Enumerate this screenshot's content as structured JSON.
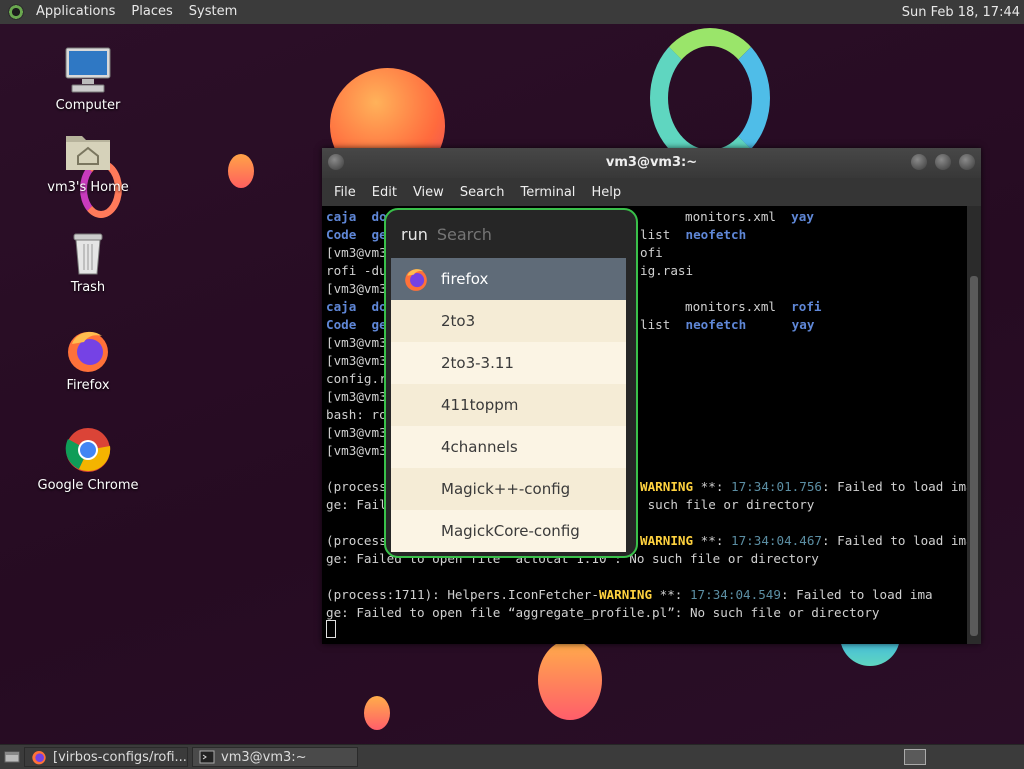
{
  "top_panel": {
    "menus": [
      "Applications",
      "Places",
      "System"
    ],
    "clock": "Sun Feb 18, 17:44"
  },
  "desktop_icons": [
    {
      "label": "Computer",
      "icon": "computer-icon"
    },
    {
      "label": "vm3's Home",
      "icon": "home-folder-icon"
    },
    {
      "label": "Trash",
      "icon": "trash-icon"
    },
    {
      "label": "Firefox",
      "icon": "firefox-icon"
    },
    {
      "label": "Google Chrome",
      "icon": "chrome-icon"
    }
  ],
  "terminal": {
    "title": "vm3@vm3:~",
    "menus": [
      "File",
      "Edit",
      "View",
      "Search",
      "Terminal",
      "Help"
    ],
    "lines": {
      "l1a": "caja  do",
      "l1b": "monitors.xml  ",
      "l1c": "yay",
      "l2a": "Code  ge",
      "l2b": "list  ",
      "l2c": "neofetch",
      "l3a": "[vm3@vm3",
      "l3b": "ofi",
      "l4a": "rofi -du",
      "l4b": "ig.rasi",
      "l5a": "[vm3@vm3",
      "l6a": "caja  do",
      "l6b": "monitors.xml  ",
      "l6c": "rofi",
      "l7a": "Code  ge",
      "l7b": "list  ",
      "l7c": "neofetch      ",
      "l7d": "yay",
      "l8a": "[vm3@vm3",
      "l9a": "[vm3@vm3",
      "l10a": "config.r",
      "l11a": "[vm3@vm3",
      "l12a": "bash: ro",
      "l13a": "[vm3@vm3",
      "l14a": "[vm3@vm3",
      "w1a": "(process",
      "w1b": "WARNING",
      "w1c": " **: ",
      "w1d": "17:34:01.756",
      "w1e": ": Failed to load ima",
      "w1f": "ge: Fail",
      "w1g": " such file or directory",
      "w2a": "(process",
      "w2b": "WARNING",
      "w2c": " **: ",
      "w2d": "17:34:04.467",
      "w2e": ": Failed to load ima",
      "w2f": "ge: Failed to open file “actocat 1.10”: No such file or directory",
      "w3a": "(process:1711): Helpers.IconFetcher-",
      "w3b": "WARNING",
      "w3c": " **: ",
      "w3d": "17:34:04.549",
      "w3e": ": Failed to load ima",
      "w3f": "ge: Failed to open file “aggregate_profile.pl”: No such file or directory"
    }
  },
  "rofi": {
    "prompt": "run",
    "placeholder": "Search",
    "items": [
      "firefox",
      "2to3",
      "2to3-3.11",
      "411toppm",
      "4channels",
      "Magick++-config",
      "MagickCore-config"
    ]
  },
  "taskbar": {
    "tasks": [
      {
        "label": "[virbos-configs/rofi...",
        "icon": "firefox-icon"
      },
      {
        "label": "vm3@vm3:~",
        "icon": "terminal-icon"
      }
    ]
  }
}
